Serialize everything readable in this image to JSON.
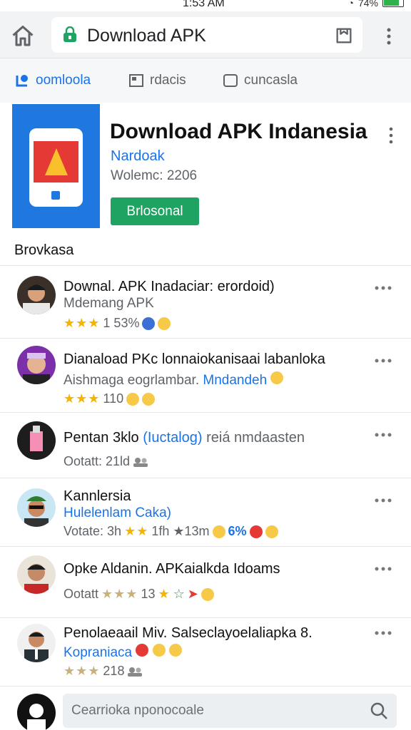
{
  "status": {
    "time": "1:53 AM",
    "battery": "74%",
    "battery_level": 0.74
  },
  "browser": {
    "url_text": "Download APK",
    "icons": {
      "home": "home-icon",
      "lock": "lock-icon",
      "tab": "tab-icon",
      "more": "more-vert-icon"
    }
  },
  "tabs": [
    {
      "label": "oomloola",
      "icon": "download-icon",
      "active": true
    },
    {
      "label": "rdacis",
      "icon": "news-icon",
      "active": false
    },
    {
      "label": "cuncasla",
      "icon": "square-icon",
      "active": false
    }
  ],
  "app": {
    "title": "Download APK Indanesia",
    "developer": "Nardoak",
    "version": "Wolemc: 2206",
    "install_label": "Brlosonal",
    "icon_color": "#1f78e0"
  },
  "section_title": "Brovkasa",
  "reviews": [
    {
      "title": "Downal. APK Inadaciar: erordoid)",
      "subtitle": "Mdemang APK",
      "stars": "★★★",
      "meta": "1 53%",
      "subtitle_link": ""
    },
    {
      "title": "Dianaload PKc lonnaiokanisaai labanloka",
      "subtitle": "Aishmaga eogrlambar.",
      "subtitle_link": "Mndandeh",
      "stars": "★★★",
      "meta": "110"
    },
    {
      "title": "Pentan 3klo",
      "title_link": "(Iuctalog)",
      "title_rest": "reiá nmdaasten",
      "subtitle": "Ootatt: 21ld",
      "stars": "",
      "meta": ""
    },
    {
      "title": "Kannlersia",
      "subtitle": "Hulelenlam Caka)",
      "subtitle_link": "",
      "meta_prefix": "Votate: 3h",
      "stars": "★★",
      "meta": "1fh ★13m",
      "extra": "6%"
    },
    {
      "title": "Opke Aldanin. APKaialkda Idoams",
      "subtitle": "Ootatt",
      "stars": "★★★",
      "meta": "13"
    },
    {
      "title": "Penolaeaail Miv. Salseclayoelaliapka 8.",
      "subtitle": "Kopraniaca",
      "stars": "★★★",
      "meta": "218"
    }
  ],
  "search": {
    "placeholder": "Cearrioka nponocoale"
  },
  "colors": {
    "accent": "#1a73e8",
    "green": "#1ea362",
    "star": "#f4b400"
  }
}
